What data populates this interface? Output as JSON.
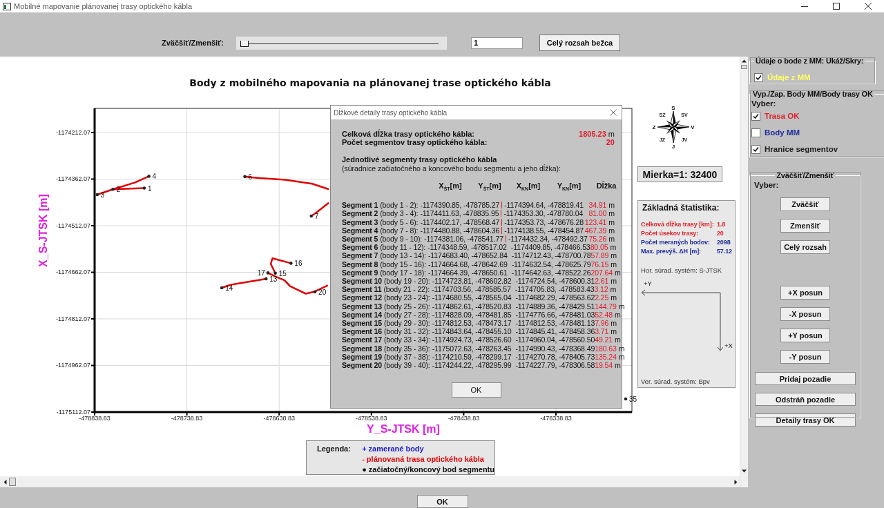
{
  "window": {
    "title": "Mobilné mapovanie plánovanej trasy optického kábla"
  },
  "toolbar": {
    "zoom_label": "Zväčšiť/Zmenšiť:",
    "zoom_slider": {
      "level": 0
    },
    "zoom_value": "1",
    "full_range_button": "Celý rozsah bežca"
  },
  "plot": {
    "chart_data": {
      "type": "line",
      "title": "Body z mobilného mapovania na plánovanej trase optického kábla",
      "xlabel": "Y_S-JTSK [m]",
      "ylabel": "X_S-JTSK [m]",
      "xlim": [
        -478838.83,
        -478256.5
      ],
      "ylim": [
        -1175112.07,
        -1174134.3
      ],
      "xticks": [
        -478838.83,
        -478738.83,
        -478638.83,
        -478538.83,
        -478438.83,
        -478338.83
      ],
      "yticks": [
        -1174212.07,
        -1174362.07,
        -1174512.07,
        -1174662.07,
        -1174812.07,
        -1174962.07,
        -1175112.07
      ],
      "grid": true,
      "series": [
        {
          "color": "#e00000",
          "x": [
            -478785,
            -478819
          ],
          "values": [
            -1174391,
            -1174395
          ]
        },
        {
          "color": "#e00000",
          "x": [
            -478836,
            -478819,
            -478795,
            -478780
          ],
          "values": [
            -1174412,
            -1174395,
            -1174373,
            -1174353
          ]
        },
        {
          "color": "#e00000",
          "x": [
            -478585,
            -478603,
            -478632,
            -478660,
            -478676
          ],
          "values": [
            -1174395,
            -1174377,
            -1174364,
            -1174359,
            -1174354
          ]
        },
        {
          "color": "#e00000",
          "x": [
            -478604,
            -478599,
            -478585
          ],
          "values": [
            -1174481,
            -1174471,
            -1174438
          ]
        },
        {
          "color": "#e00000",
          "x": [
            -478653,
            -478691,
            -478701
          ],
          "values": [
            -1174683,
            -1174702,
            -1174712
          ]
        },
        {
          "color": "#e00000",
          "x": [
            -478643,
            -478648,
            -478646,
            -478626
          ],
          "values": [
            -1174665,
            -1174635,
            -1174617,
            -1174633
          ]
        },
        {
          "color": "#e00000",
          "x": [
            -478651,
            -478642,
            -478633,
            -478627,
            -478610,
            -478601,
            -478586
          ],
          "values": [
            -1174664,
            -1174677,
            -1174688,
            -1174707,
            -1174731,
            -1174725,
            -1174704
          ]
        }
      ],
      "annotations": [
        {
          "x": -478785,
          "y": -1174391,
          "text": "1"
        },
        {
          "x": -478819,
          "y": -1174395,
          "text": "2"
        },
        {
          "x": -478836,
          "y": -1174412,
          "text": "3"
        },
        {
          "x": -478780,
          "y": -1174353,
          "text": "4"
        },
        {
          "x": -478676,
          "y": -1174354,
          "text": "6"
        },
        {
          "x": -478604,
          "y": -1174481,
          "text": "7"
        },
        {
          "x": -478653,
          "y": -1174683,
          "text": "13"
        },
        {
          "x": -478701,
          "y": -1174712,
          "text": "14"
        },
        {
          "x": -478651,
          "y": -1174664,
          "text": "17"
        },
        {
          "x": -478643,
          "y": -1174665,
          "text": "15"
        },
        {
          "x": -478626,
          "y": -1174633,
          "text": "16"
        },
        {
          "x": -478600,
          "y": -1174725,
          "text": "20"
        }
      ]
    },
    "edge_point_label": "35",
    "compass": {
      "labels": [
        "S",
        "SV",
        "V",
        "JV",
        "J",
        "JZ",
        "Z",
        "SZ"
      ]
    },
    "scale": "Mierka=1: 32400",
    "stats": {
      "title": "Základná štatistika:",
      "rows": [
        {
          "label": "Celková dĺžka trasy [km]:",
          "value": "1.8",
          "color": "#e0202a"
        },
        {
          "label": "Počet úsekov trasy:",
          "value": "20",
          "color": "#e0202a"
        },
        {
          "label": "Počet meraných bodov:",
          "value": "2098",
          "color": "#1c2a9c"
        },
        {
          "label": "Max. prevýš. ΔH [m]:",
          "value": "57.12",
          "color": "#1c2a9c"
        }
      ],
      "horizontal_system": "Hor. súrad. systém: S-JTSK",
      "axis_y": "+Y",
      "axis_x": "+X",
      "vertical_system": "Ver. súrad. systém: Bpv"
    },
    "legend": {
      "title": "Legenda:",
      "items": [
        {
          "text": "+ zamerané body",
          "color": "#1a1acc"
        },
        {
          "text": "- plánovaná trasa optického kábla",
          "color": "#e00000"
        },
        {
          "text": "● začiatočný/koncový bod segmentu",
          "color": "#111111"
        }
      ]
    }
  },
  "dialog": {
    "title": "Dĺžkové detaily trasy optického kábla",
    "summary": [
      {
        "label": "Celková dĺžka trasy optického kábla:",
        "value": "1805.23",
        "unit": "m"
      },
      {
        "label": "Počet segmentov trasy optického kábla:",
        "value": "20"
      }
    ],
    "section_title": "Jednotlivé segmenty trasy optického kábla",
    "section_note": "(súradnice začiatočného a koncového bodu segmentu a jeho dĺžka):",
    "columns": [
      "X$_{ŠT}$[m]",
      "Y$_{ŠT}$[m]",
      "X$_{KN}$[m]",
      "Y$_{KN}$[m]",
      "Dĺžka"
    ],
    "segments": [
      {
        "name": "Segment 1",
        "points": "(body 1 - 2):",
        "start": "-1174390.85, -478785.27",
        "end": "-1174394.64, -478819.41",
        "length": "34.91",
        "unit": "m"
      },
      {
        "name": "Segment 2",
        "points": "(body 3 - 4):",
        "start": "-1174411.63, -478835.95",
        "end": "-1174353.30, -478780.04",
        "length": "81.00",
        "unit": "m"
      },
      {
        "name": "Segment 3",
        "points": "(body 5 - 6):",
        "start": "-1174402.17, -478568.47",
        "end": "-1174353.73, -478676.28",
        "length": "123.41",
        "unit": "m"
      },
      {
        "name": "Segment 4",
        "points": "(body 7 - 8):",
        "start": "-1174480.88, -478604.36",
        "end": "-1174138.55, -478454.87",
        "length": "467.39",
        "unit": "m"
      },
      {
        "name": "Segment 5",
        "points": "(body 9 - 10):",
        "start": "-1174381.06, -478541.77",
        "end": "-1174432.34, -478492.37",
        "length": "75.26",
        "unit": "m"
      },
      {
        "name": "Segment 6",
        "points": "(body 11 - 12):",
        "start": "-1174348.59, -478517.02",
        "end": "-1174409.85, -478466.53",
        "length": "80.05",
        "unit": "m"
      },
      {
        "name": "Segment 7",
        "points": "(body 13 - 14):",
        "start": "-1174683.40, -478652.84",
        "end": "-1174712.43, -478700.78",
        "length": "57.89",
        "unit": "m"
      },
      {
        "name": "Segment 8",
        "points": "(body 15 - 16):",
        "start": "-1174664.68, -478642.69",
        "end": "-1174632.54, -478625.79",
        "length": "76.15",
        "unit": "m"
      },
      {
        "name": "Segment 9",
        "points": "(body 17 - 18):",
        "start": "-1174664.39, -478650.61",
        "end": "-1174642.63, -478522.26",
        "length": "207.64",
        "unit": "m"
      },
      {
        "name": "Segment 10",
        "points": "(body 19 - 20):",
        "start": "-1174723.81, -478602.82",
        "end": "-1174724.54, -478600.31",
        "length": "2.61",
        "unit": "m"
      },
      {
        "name": "Segment 11",
        "points": "(body 21 - 22):",
        "start": "-1174703.56, -478585.57",
        "end": "-1174705.83, -478583.43",
        "length": "3.12",
        "unit": "m"
      },
      {
        "name": "Segment 12",
        "points": "(body 23 - 24):",
        "start": "-1174680.55, -478565.04",
        "end": "-1174682.29, -478563.62",
        "length": "2.25",
        "unit": "m"
      },
      {
        "name": "Segment 13",
        "points": "(body 25 - 26):",
        "start": "-1174862.61, -478520.83",
        "end": "-1174889.36, -478429.51",
        "length": "144.79",
        "unit": "m"
      },
      {
        "name": "Segment 14",
        "points": "(body 27 - 28):",
        "start": "-1174828.09, -478481.85",
        "end": "-1174776.66, -478481.03",
        "length": "52.48",
        "unit": "m"
      },
      {
        "name": "Segment 15",
        "points": "(body 29 - 30):",
        "start": "-1174812.53, -478473.17",
        "end": "-1174812.53, -478481.13",
        "length": "7.96",
        "unit": "m"
      },
      {
        "name": "Segment 16",
        "points": "(body 31 - 32):",
        "start": "-1174843.64, -478455.10",
        "end": "-1174845.41, -478458.36",
        "length": "3.71",
        "unit": "m"
      },
      {
        "name": "Segment 17",
        "points": "(body 33 - 34):",
        "start": "-1174924.73, -478526.60",
        "end": "-1174960.04, -478560.50",
        "length": "49.21",
        "unit": "m"
      },
      {
        "name": "Segment 18",
        "points": "(body 35 - 36):",
        "start": "-1175072.63, -478263.45",
        "end": "-1174990.43, -478368.49",
        "length": "180.63",
        "unit": "m"
      },
      {
        "name": "Segment 19",
        "points": "(body 37 - 38):",
        "start": "-1174210.59, -478299.17",
        "end": "-1174270.78, -478405.73",
        "length": "135.24",
        "unit": "m"
      },
      {
        "name": "Segment 20",
        "points": "(body 39 - 40):",
        "start": "-1174244.22, -478295.99",
        "end": "-1174227.79, -478306.58",
        "length": "19.54",
        "unit": "m"
      }
    ],
    "ok_button": "OK"
  },
  "side_panel": {
    "point_info": {
      "legend": "Údaje o bode z MM: Ukáž/Skry:",
      "checkboxes": [
        {
          "label": "Údaje z MM",
          "checked": true,
          "color": "#ffff66"
        }
      ]
    },
    "layers": {
      "legend": "Vyp./Zap. Body MM/Body trasy OK",
      "prompt": "Vyber:",
      "checkboxes": [
        {
          "label": "Trasa OK",
          "checked": true,
          "color": "#e0202a"
        },
        {
          "label": "Body MM",
          "checked": false,
          "color": "#1c2a9c"
        },
        {
          "label": "Hranice segmentov",
          "checked": true,
          "color": "#202020"
        }
      ]
    },
    "zoom": {
      "legend": "Zväčšiť/Zmenšiť",
      "prompt": "Vyber:",
      "view_buttons": [
        "Zväčšiť",
        "Zmenšiť",
        "Celý rozsah"
      ],
      "pan_buttons": [
        "+X posun",
        "-X posun",
        "+Y posun",
        "-Y posun"
      ],
      "background_buttons": [
        "Pridaj pozadie",
        "Odstráň pozadie",
        "Detaily trasy OK"
      ]
    }
  },
  "ok_button": "OK"
}
